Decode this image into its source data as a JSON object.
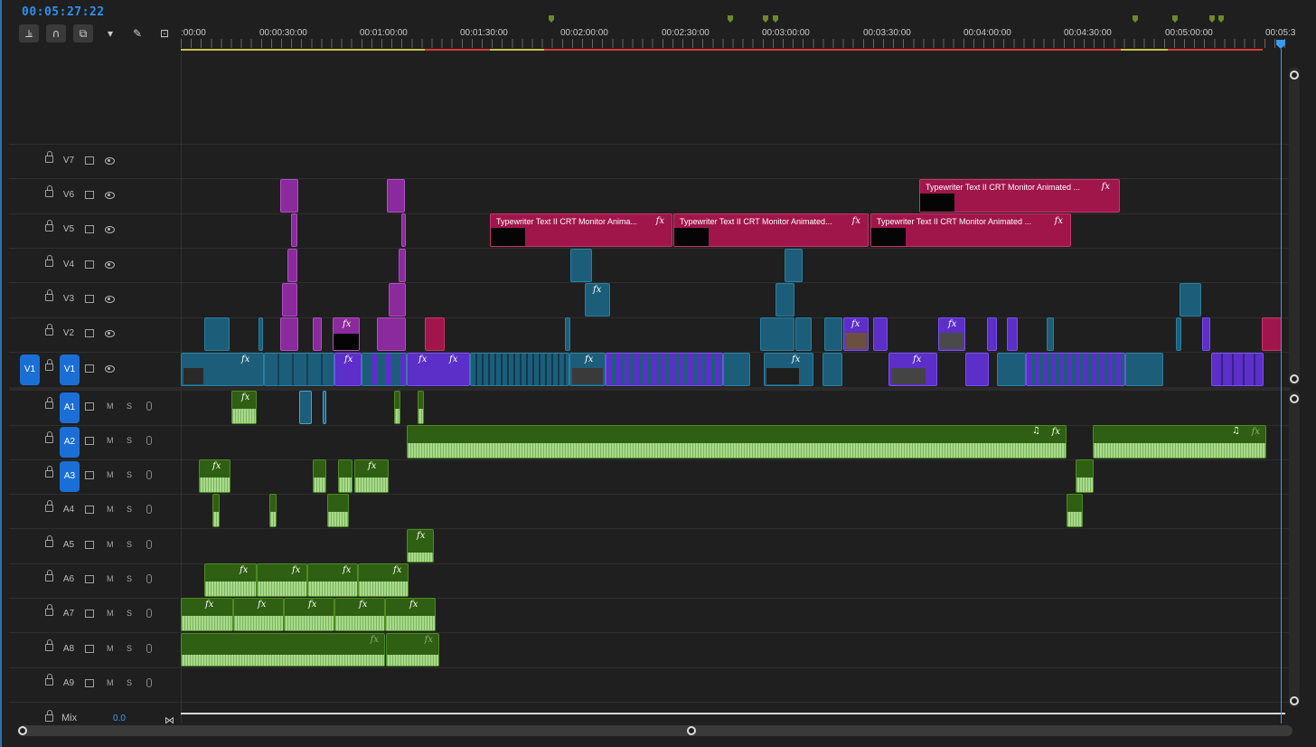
{
  "timecode": "00:05:27:22",
  "toolbar": [
    {
      "name": "insert-tool",
      "icon": "⫡"
    },
    {
      "name": "snap-tool",
      "icon": "∩"
    },
    {
      "name": "linked-selection-tool",
      "icon": "⧉"
    },
    {
      "name": "add-marker-tool",
      "icon": "▾"
    },
    {
      "name": "settings-tool",
      "icon": "✎"
    },
    {
      "name": "captions-tool",
      "icon": "⊡"
    }
  ],
  "ruler": {
    "labels": [
      ":00:00",
      "00:00:30:00",
      "00:01:00:00",
      "00:01:30:00",
      "00:02:00:00",
      "00:02:30:00",
      "00:03:00:00",
      "00:03:30:00",
      "00:04:00:00",
      "00:04:30:00",
      "00:05:00:00",
      "00:05:3"
    ]
  },
  "source_patch": {
    "video": "V1"
  },
  "video_tracks": [
    "V7",
    "V6",
    "V5",
    "V4",
    "V3",
    "V2",
    "V1"
  ],
  "audio_tracks": [
    {
      "name": "A1",
      "m": "M",
      "s": "S"
    },
    {
      "name": "A2",
      "m": "M",
      "s": "S"
    },
    {
      "name": "A3",
      "m": "M",
      "s": "S"
    },
    {
      "name": "A4",
      "m": "M",
      "s": "S"
    },
    {
      "name": "A5",
      "m": "M",
      "s": "S"
    },
    {
      "name": "A6",
      "m": "M",
      "s": "S"
    },
    {
      "name": "A7",
      "m": "M",
      "s": "S"
    },
    {
      "name": "A8",
      "m": "M",
      "s": "S"
    },
    {
      "name": "A9",
      "m": "M",
      "s": "S"
    }
  ],
  "mix": {
    "label": "Mix",
    "value": "0.0"
  },
  "titles": {
    "v6": "Typewriter Text II CRT Monitor Animated ...",
    "v5a": "Typewriter Text II CRT Monitor Anima...",
    "v5b": "Typewriter Text II CRT Monitor Animated...",
    "v5c": "Typewriter Text II CRT Monitor Animated ..."
  },
  "fx_label": "fx",
  "music_icon": "♫",
  "colors": {
    "accent": "#1a6fd6",
    "video_clip": "#1c5e7a",
    "purple_clip": "#5b2fc8",
    "magenta_clip": "#8a2a9c",
    "title_clip": "#a0164a",
    "audio_clip": "#2f5f12",
    "playhead": "#3a9af3"
  }
}
